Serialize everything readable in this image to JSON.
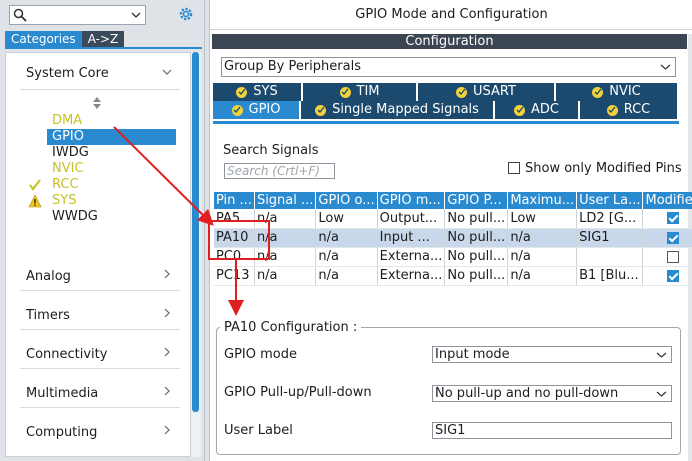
{
  "left": {
    "search": {
      "placeholder": ""
    },
    "tabs": [
      {
        "label": "Categories"
      },
      {
        "label": "A->Z"
      }
    ],
    "categories": [
      {
        "label": "System Core"
      },
      {
        "label": "Analog"
      },
      {
        "label": "Timers"
      },
      {
        "label": "Connectivity"
      },
      {
        "label": "Multimedia"
      },
      {
        "label": "Computing"
      }
    ],
    "items": [
      {
        "label": "DMA",
        "status": "yellow"
      },
      {
        "label": "GPIO",
        "status": "selected"
      },
      {
        "label": "IWDG",
        "status": "normal"
      },
      {
        "label": "NVIC",
        "status": "yellow"
      },
      {
        "label": "RCC",
        "status": "check"
      },
      {
        "label": "SYS",
        "status": "warning"
      },
      {
        "label": "WWDG",
        "status": "normal"
      }
    ]
  },
  "right": {
    "title": "GPIO Mode and Configuration",
    "config_bar": "Configuration",
    "group_by": "Group By Peripherals",
    "tabs_row1": [
      {
        "label": "SYS"
      },
      {
        "label": "TIM"
      },
      {
        "label": "USART"
      },
      {
        "label": "NVIC"
      }
    ],
    "tabs_row2": [
      {
        "label": "GPIO"
      },
      {
        "label": "Single Mapped Signals"
      },
      {
        "label": "ADC"
      },
      {
        "label": "RCC"
      }
    ],
    "search_signals_label": "Search Signals",
    "search_placeholder": "Search (Crtl+F)",
    "show_modified_label": "Show only Modified Pins",
    "table": {
      "headers": [
        "Pin ...",
        "Signal ...",
        "GPIO o...",
        "GPIO m...",
        "GPIO P...",
        "Maximu...",
        "User La...",
        "Modified"
      ],
      "rows": [
        {
          "cells": [
            "PA5",
            "n/a",
            "Low",
            "Output...",
            "No pull...",
            "Low",
            "LD2 [G...",
            ""
          ],
          "modified": true
        },
        {
          "cells": [
            "PA10",
            "n/a",
            "n/a",
            "Input ...",
            "No pull...",
            "n/a",
            "SIG1",
            ""
          ],
          "modified": true
        },
        {
          "cells": [
            "PC0",
            "n/a",
            "n/a",
            "Externa...",
            "No pull...",
            "n/a",
            "",
            ""
          ],
          "modified": false
        },
        {
          "cells": [
            "PC13",
            "n/a",
            "n/a",
            "Externa...",
            "No pull...",
            "n/a",
            "B1 [Blu...",
            ""
          ],
          "modified": true
        }
      ]
    },
    "pin_config": {
      "legend": "PA10 Configuration :",
      "gpio_mode_label": "GPIO mode",
      "gpio_mode_value": "Input mode",
      "pull_label": "GPIO Pull-up/Pull-down",
      "pull_value": "No pull-up and no pull-down",
      "user_label_label": "User Label",
      "user_label_value": "SIG1"
    }
  },
  "colors": {
    "accent": "#2a8ad0",
    "dark_tab": "#1c4a6e",
    "annotation": "#e02020",
    "warn": "#c7c227"
  }
}
